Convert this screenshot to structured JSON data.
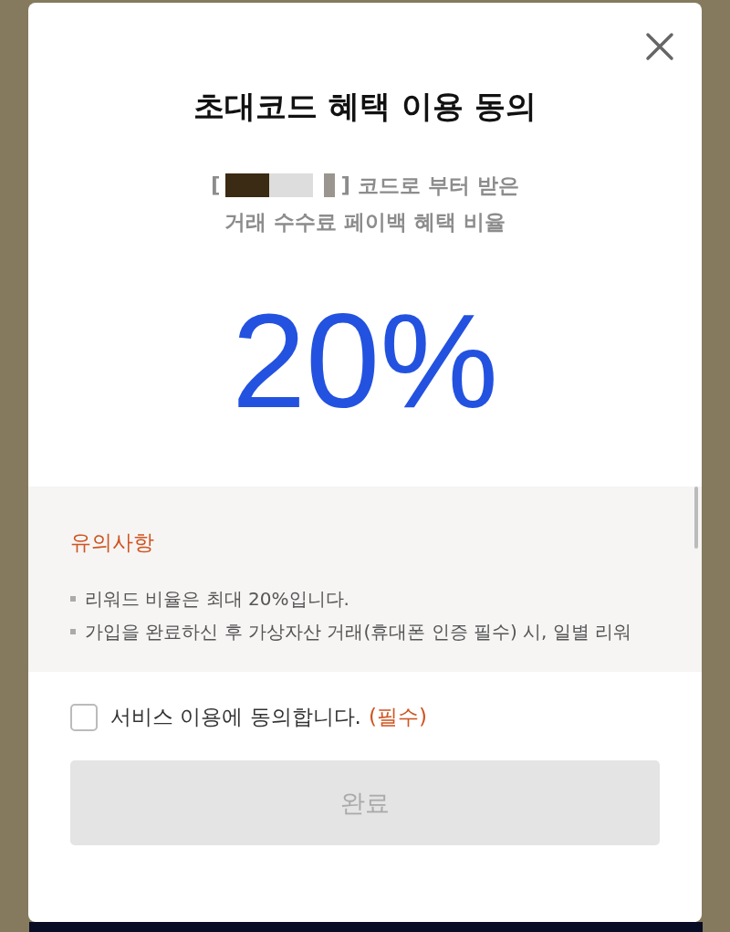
{
  "modal": {
    "title": "초대코드 혜택 이용 동의",
    "code_line": {
      "open": "[",
      "close": "] 코드로 부터 받은"
    },
    "subtitle": "거래 수수료 페이백 혜택 비율",
    "rate": "20%",
    "notice": {
      "heading": "유의사항",
      "items": [
        "리워드 비율은 최대 20%입니다.",
        "가입을 완료하신 후 가상자산 거래(휴대폰 인증 필수) 시, 일별 리워"
      ]
    },
    "agreement": {
      "label": "서비스 이용에 동의합니다.",
      "required": "(필수)",
      "checked": false
    },
    "submit": {
      "label": "완료",
      "disabled": true
    }
  }
}
